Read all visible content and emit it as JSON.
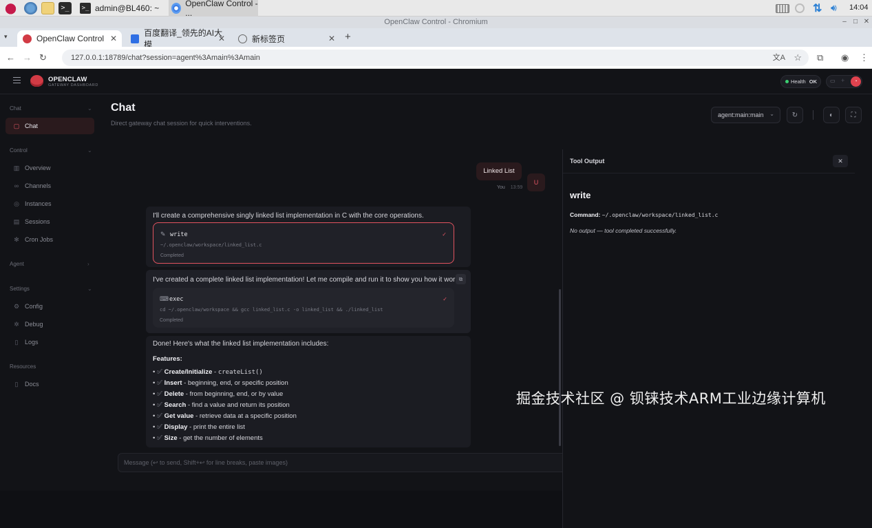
{
  "taskbar": {
    "terminal_task": "admin@BL460: ~",
    "browser_task": "OpenClaw Control - ...",
    "clock": "14:04"
  },
  "window": {
    "title": "OpenClaw Control - Chromium"
  },
  "tabs": [
    {
      "label": "OpenClaw Control"
    },
    {
      "label": "百度翻译_领先的AI大模"
    },
    {
      "label": "新标签页"
    }
  ],
  "address": {
    "url": "127.0.0.1:18789/chat?session=agent%3Amain%3Amain"
  },
  "brand": {
    "name": "OPENCLAW",
    "subtitle": "GATEWAY DASHBOARD"
  },
  "health": {
    "label": "Health",
    "status": "OK"
  },
  "sidebar": {
    "groups": [
      {
        "label": "Chat",
        "items": [
          {
            "label": "Chat",
            "icon": "chat-icon"
          }
        ]
      },
      {
        "label": "Control",
        "items": [
          {
            "label": "Overview",
            "icon": "bar-chart-icon"
          },
          {
            "label": "Channels",
            "icon": "link-icon"
          },
          {
            "label": "Instances",
            "icon": "radio-icon"
          },
          {
            "label": "Sessions",
            "icon": "document-icon"
          },
          {
            "label": "Cron Jobs",
            "icon": "loader-icon"
          }
        ]
      },
      {
        "label": "Agent",
        "items": []
      },
      {
        "label": "Settings",
        "items": [
          {
            "label": "Config",
            "icon": "gear-icon"
          },
          {
            "label": "Debug",
            "icon": "bug-icon"
          },
          {
            "label": "Logs",
            "icon": "file-icon"
          }
        ]
      },
      {
        "label": "Resources",
        "items": [
          {
            "label": "Docs",
            "icon": "book-icon"
          }
        ]
      }
    ]
  },
  "page": {
    "title": "Chat",
    "subtitle": "Direct gateway chat session for quick interventions.",
    "session_select": "agent:main:main"
  },
  "chat": {
    "user_message": "Linked List",
    "user_name": "You",
    "user_time": "13:59",
    "user_avatar": "U",
    "msg1_text": "I'll create a comprehensive singly linked list implementation in C with the core operations.",
    "tool1": {
      "name": "write",
      "command": "~/.openclaw/workspace/linked_list.c",
      "status": "Completed"
    },
    "msg2_text": "I've created a complete linked list implementation! Let me compile and run it to show you how it works:",
    "tool2": {
      "name": "exec",
      "command": "cd ~/.openclaw/workspace && gcc linked_list.c -o linked_list && ./linked_list",
      "status": "Completed"
    },
    "msg3_text": "Done! Here's what the linked list implementation includes:",
    "features_heading": "Features:",
    "features": [
      {
        "name": "Create/Initialize",
        "desc": " - ",
        "code": "createList()"
      },
      {
        "name": "Insert",
        "desc": " - beginning, end, or specific position",
        "code": ""
      },
      {
        "name": "Delete",
        "desc": " - from beginning, end, or by value",
        "code": ""
      },
      {
        "name": "Search",
        "desc": " - find a value and return its position",
        "code": ""
      },
      {
        "name": "Get value",
        "desc": " - retrieve data at a specific position",
        "code": ""
      },
      {
        "name": "Display",
        "desc": " - print the entire list",
        "code": ""
      },
      {
        "name": "Size",
        "desc": " - get the number of elements",
        "code": ""
      }
    ],
    "composer_placeholder": "Message (↩ to send, Shift+↩ for line breaks, paste images)"
  },
  "tool_output": {
    "header": "Tool Output",
    "tool_name": "write",
    "command_label": "Command:",
    "command_value": "~/.openclaw/workspace/linked_list.c",
    "result": "No output — tool completed successfully."
  },
  "watermark": "掘金技术社区 @ 钡铼技术ARM工业边缘计算机",
  "colors": {
    "accent": "#e05563",
    "background": "#121317",
    "card": "#1b1c22"
  }
}
